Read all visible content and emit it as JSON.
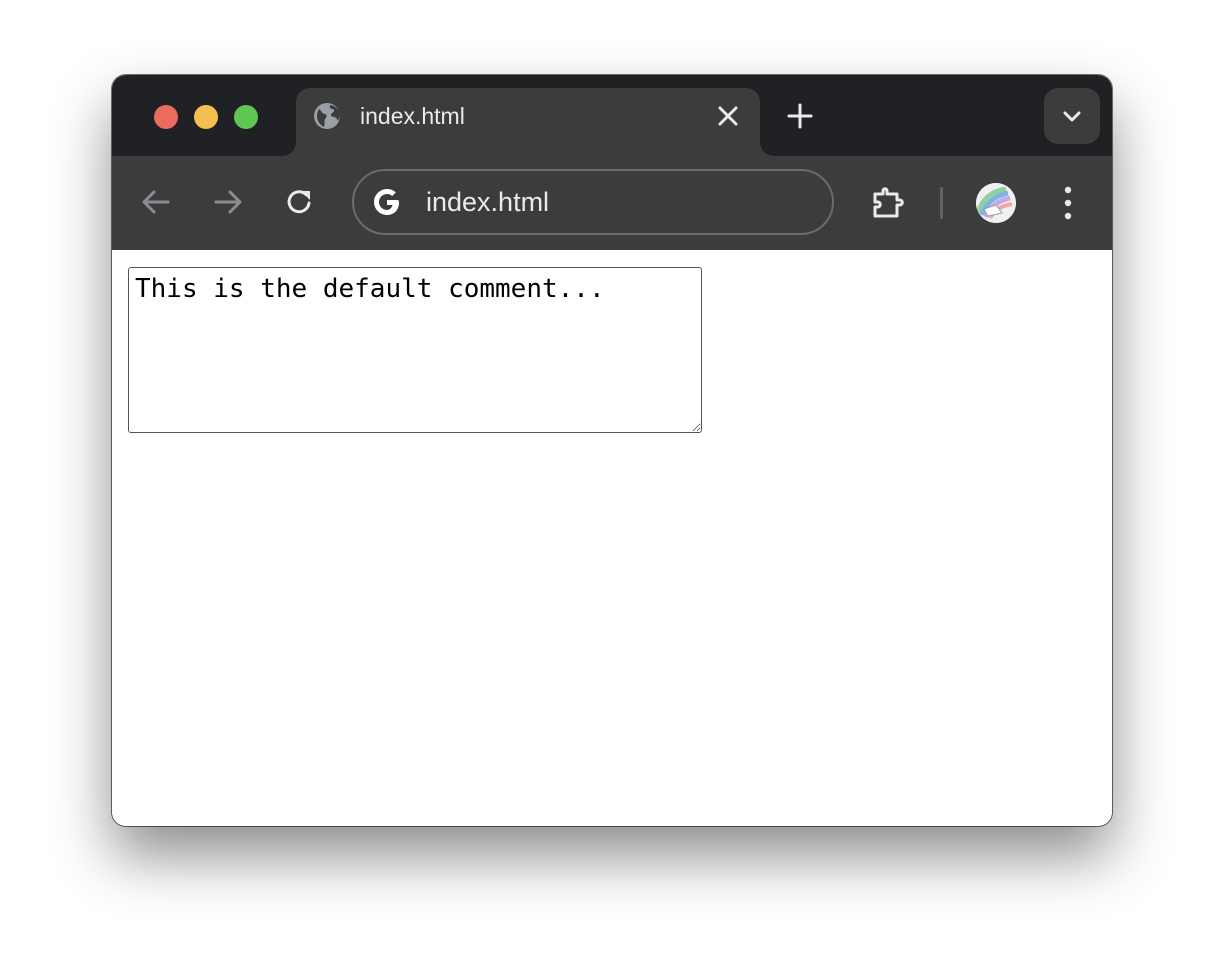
{
  "browser": {
    "tab": {
      "title": "index.html",
      "favicon": "globe-icon",
      "close_icon": "close-icon"
    },
    "new_tab_icon": "plus-icon",
    "tab_search_icon": "chevron-down-icon",
    "toolbar": {
      "back_icon": "arrow-left-icon",
      "forward_icon": "arrow-right-icon",
      "reload_icon": "reload-icon",
      "omnibox": {
        "icon": "google-g-icon",
        "url": "index.html"
      },
      "extensions_icon": "puzzle-icon",
      "profile_icon": "avatar",
      "menu_icon": "more-vertical-icon"
    },
    "window_controls": {
      "close_color": "#ed6a5e",
      "minimize_color": "#f5bf4f",
      "maximize_color": "#61c554"
    },
    "theme": {
      "tabstrip_bg": "#202124",
      "toolbar_bg": "#3c3c3c",
      "text_color": "#e8eaed"
    }
  },
  "page": {
    "comment": {
      "value": "This is the default comment..."
    }
  }
}
